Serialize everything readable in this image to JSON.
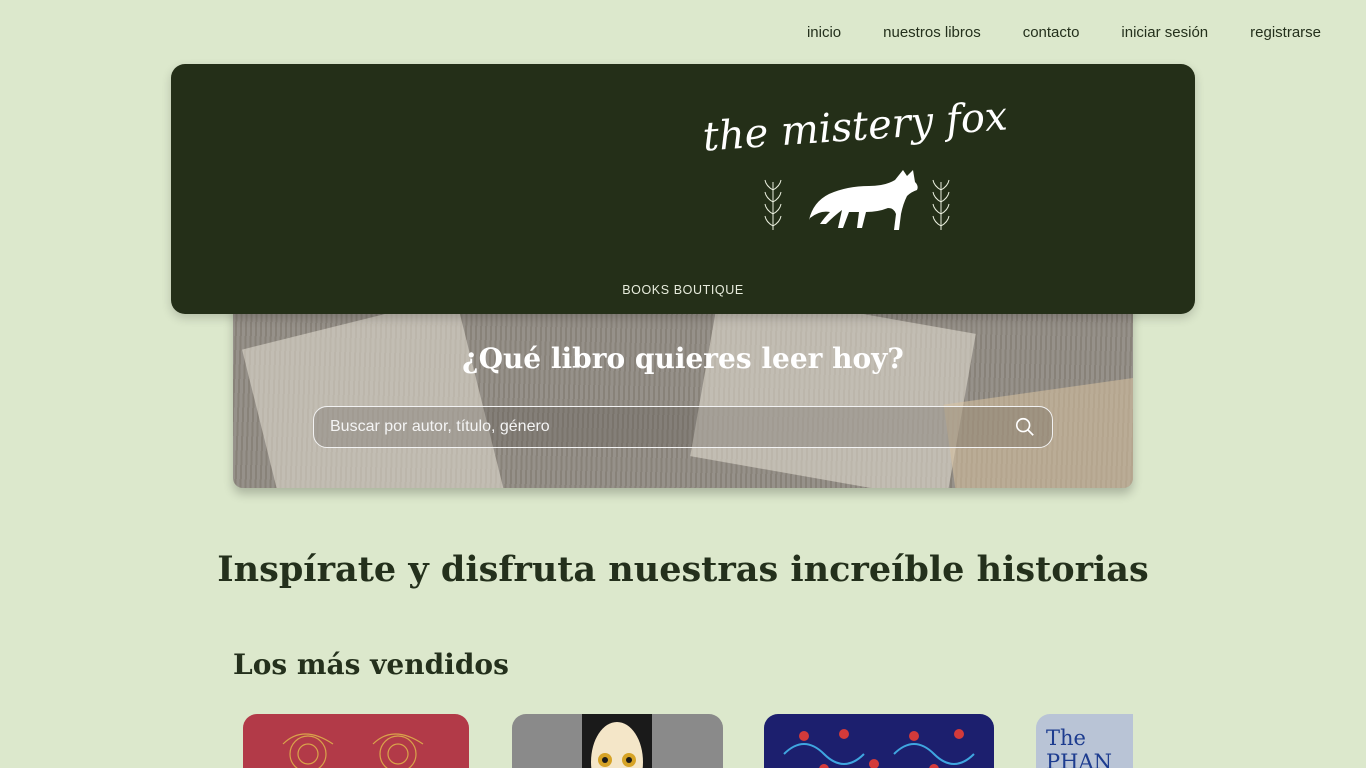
{
  "nav": {
    "items": [
      "inicio",
      "nuestros libros",
      "contacto",
      "iniciar sesión",
      "registrarse"
    ]
  },
  "brand": {
    "name": "the mistery fox",
    "tagline": "BOOKS BOUTIQUE"
  },
  "hero": {
    "title": "¿Qué libro quieres leer hoy?",
    "search_placeholder": "Buscar por autor, título, género"
  },
  "main": {
    "tagline": "Inspírate y disfruta nuestras increíble historias",
    "bestsellers_title": "Los más vendidos",
    "book4_cover_text": "The PHAN"
  },
  "colors": {
    "background": "#dce8cc",
    "brand_panel": "#242f18",
    "text_dark": "#24301c"
  }
}
